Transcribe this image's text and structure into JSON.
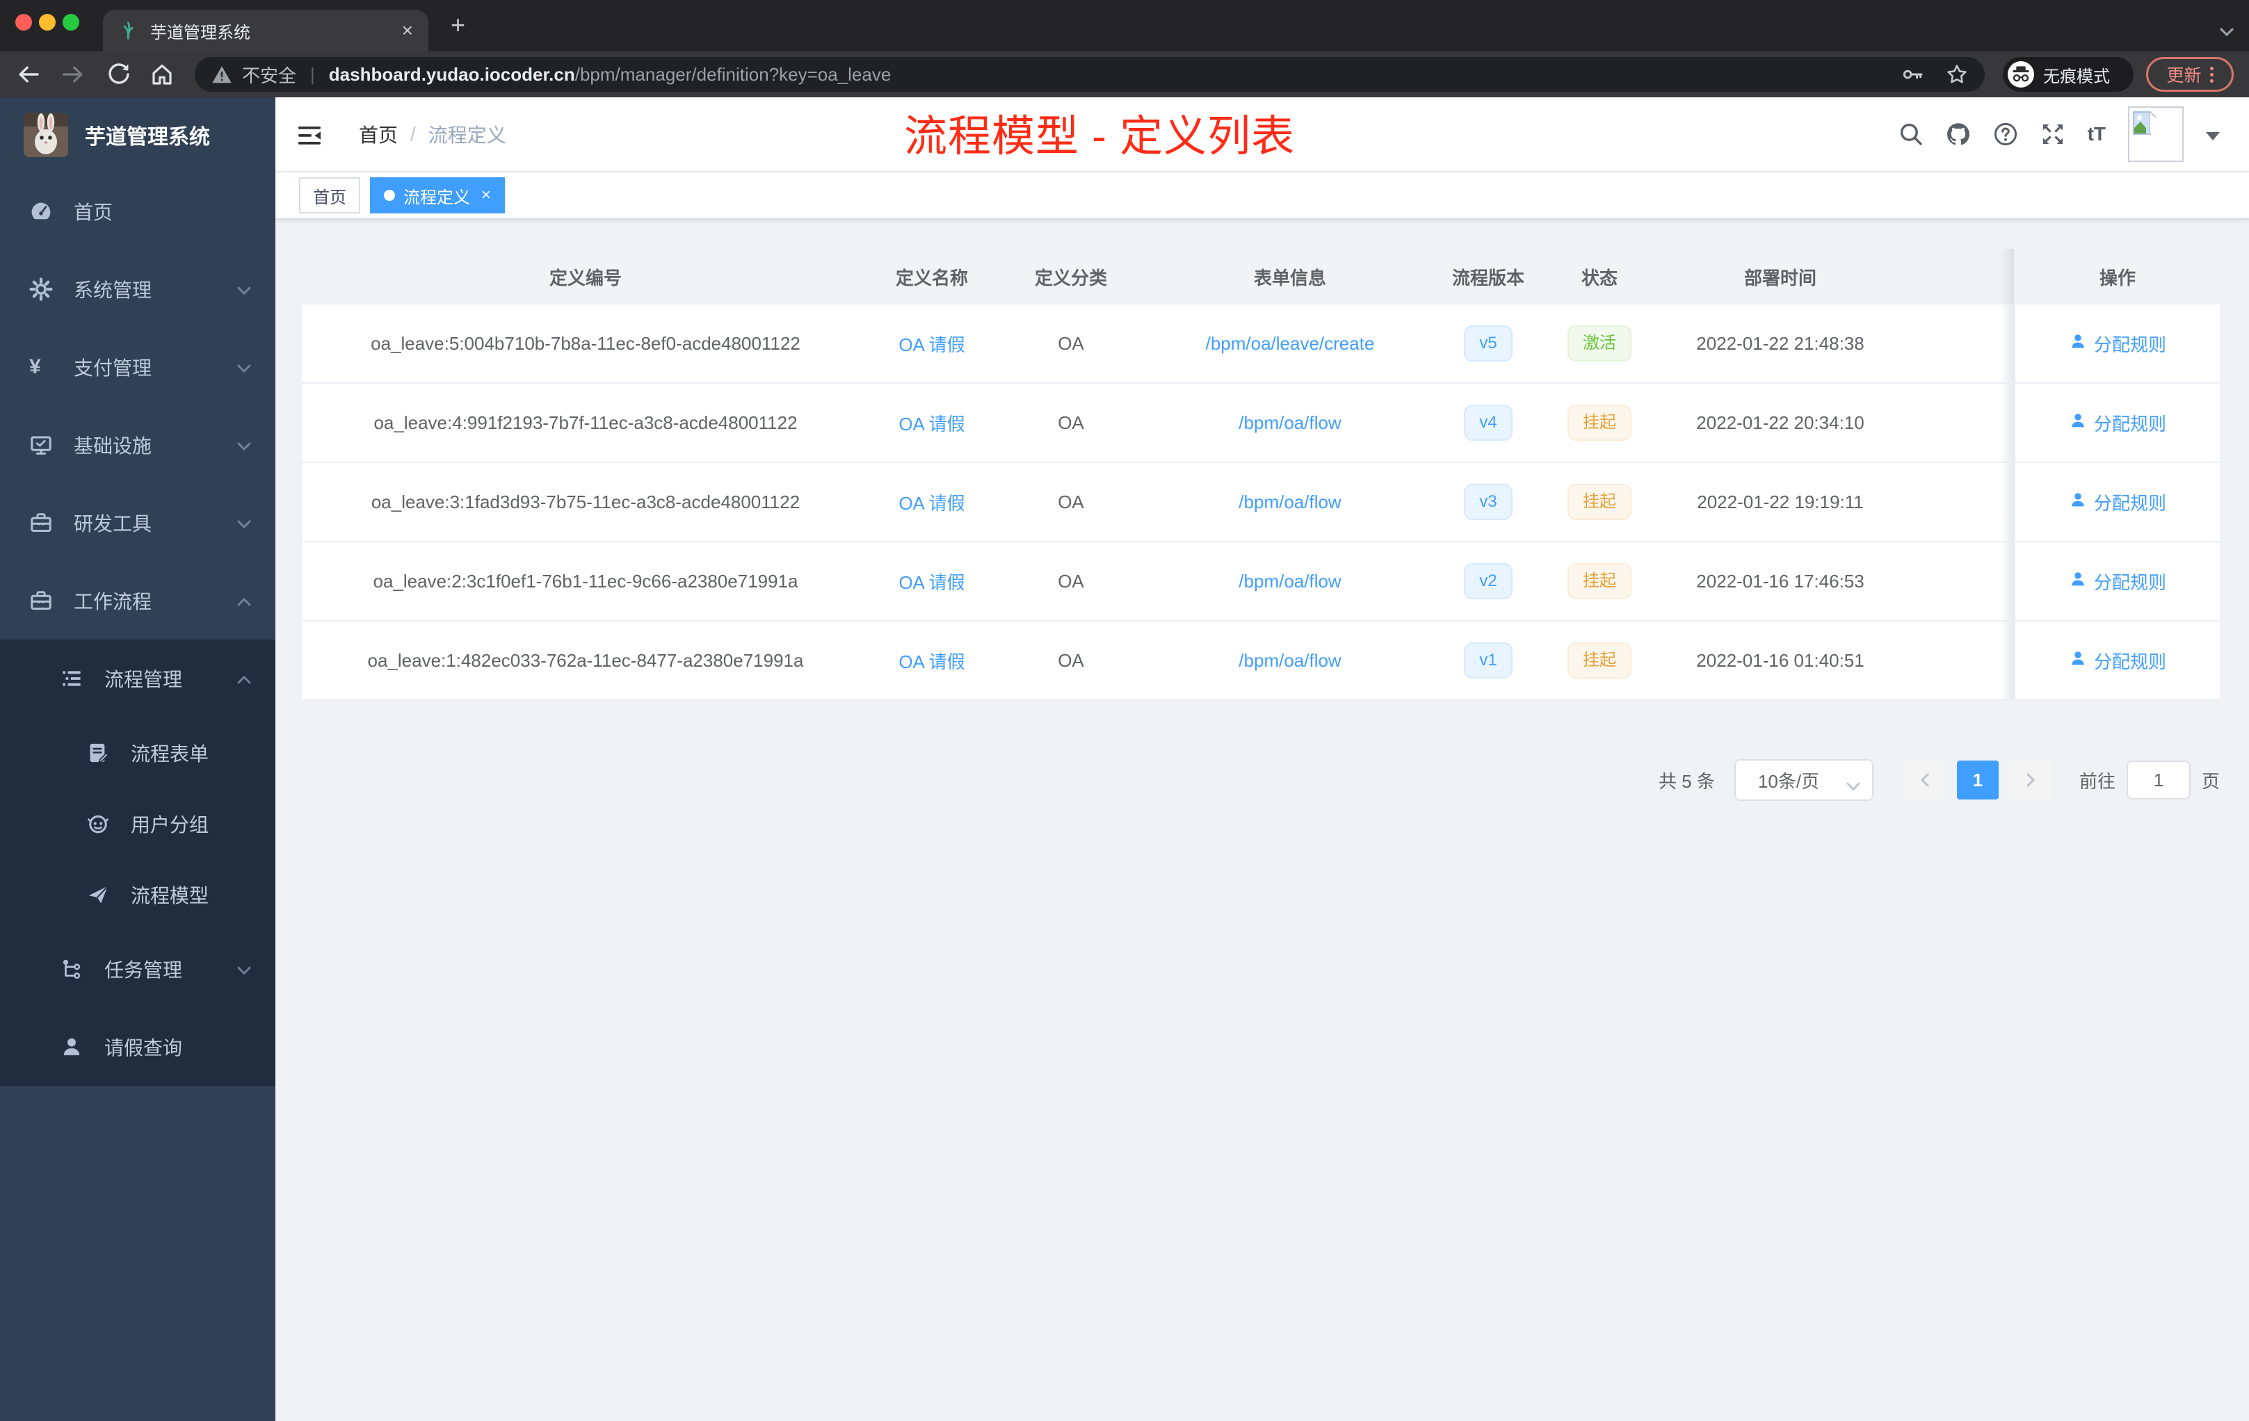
{
  "browser": {
    "tab_title": "芋道管理系统",
    "tab_close": "×",
    "new_tab": "+",
    "security_label": "不安全",
    "url_host": "dashboard.yudao.iocoder.cn",
    "url_path": "/bpm/manager/definition?key=oa_leave",
    "incognito_label": "无痕模式",
    "update_label": "更新"
  },
  "sidebar": {
    "title": "芋道管理系统",
    "menu": [
      {
        "key": "home",
        "label": "首页",
        "icon": "dashboard-icon",
        "level": 1,
        "sub": false,
        "arrow": ""
      },
      {
        "key": "system",
        "label": "系统管理",
        "icon": "gear-icon",
        "level": 1,
        "sub": false,
        "arrow": "down"
      },
      {
        "key": "payment",
        "label": "支付管理",
        "icon": "yen-icon",
        "level": 1,
        "sub": false,
        "arrow": "down"
      },
      {
        "key": "infra",
        "label": "基础设施",
        "icon": "monitor-icon",
        "level": 1,
        "sub": false,
        "arrow": "down"
      },
      {
        "key": "devtools",
        "label": "研发工具",
        "icon": "toolbox-icon",
        "level": 1,
        "sub": false,
        "arrow": "down"
      },
      {
        "key": "workflow",
        "label": "工作流程",
        "icon": "toolbox-icon",
        "level": 1,
        "sub": false,
        "arrow": "up"
      },
      {
        "key": "process-manage",
        "label": "流程管理",
        "icon": "list-tree-icon",
        "level": 2,
        "sub": true,
        "arrow": "up"
      },
      {
        "key": "process-form",
        "label": "流程表单",
        "icon": "form-edit-icon",
        "level": 3,
        "sub": true,
        "arrow": ""
      },
      {
        "key": "user-group",
        "label": "用户分组",
        "icon": "robot-icon",
        "level": 3,
        "sub": true,
        "arrow": ""
      },
      {
        "key": "process-model",
        "label": "流程模型",
        "icon": "paper-plane-icon",
        "level": 3,
        "sub": true,
        "arrow": ""
      },
      {
        "key": "task-manage",
        "label": "任务管理",
        "icon": "tasks-icon",
        "level": 2,
        "sub": true,
        "arrow": "down"
      },
      {
        "key": "leave-query",
        "label": "请假查询",
        "icon": "user-icon",
        "level": 2,
        "sub": true,
        "arrow": ""
      }
    ]
  },
  "app_header": {
    "breadcrumb": [
      "首页",
      "流程定义"
    ],
    "breadcrumb_sep": "/",
    "annotation": "流程模型 - 定义列表"
  },
  "tags": [
    {
      "label": "首页",
      "active": false
    },
    {
      "label": "流程定义",
      "active": true,
      "close": "×"
    }
  ],
  "table": {
    "columns": [
      "定义编号",
      "定义名称",
      "定义分类",
      "表单信息",
      "流程版本",
      "状态",
      "部署时间",
      "操作"
    ],
    "action_label": "分配规则",
    "rows": [
      {
        "id": "oa_leave:5:004b710b-7b8a-11ec-8ef0-acde48001122",
        "name": "OA 请假",
        "category": "OA",
        "form": "/bpm/oa/leave/create",
        "version": "v5",
        "status": "激活",
        "status_type": "success",
        "time": "2022-01-22 21:48:38"
      },
      {
        "id": "oa_leave:4:991f2193-7b7f-11ec-a3c8-acde48001122",
        "name": "OA 请假",
        "category": "OA",
        "form": "/bpm/oa/flow",
        "version": "v4",
        "status": "挂起",
        "status_type": "warning",
        "time": "2022-01-22 20:34:10"
      },
      {
        "id": "oa_leave:3:1fad3d93-7b75-11ec-a3c8-acde48001122",
        "name": "OA 请假",
        "category": "OA",
        "form": "/bpm/oa/flow",
        "version": "v3",
        "status": "挂起",
        "status_type": "warning",
        "time": "2022-01-22 19:19:11"
      },
      {
        "id": "oa_leave:2:3c1f0ef1-76b1-11ec-9c66-a2380e71991a",
        "name": "OA 请假",
        "category": "OA",
        "form": "/bpm/oa/flow",
        "version": "v2",
        "status": "挂起",
        "status_type": "warning",
        "time": "2022-01-16 17:46:53"
      },
      {
        "id": "oa_leave:1:482ec033-762a-11ec-8477-a2380e71991a",
        "name": "OA 请假",
        "category": "OA",
        "form": "/bpm/oa/flow",
        "version": "v1",
        "status": "挂起",
        "status_type": "warning",
        "time": "2022-01-16 01:40:51"
      }
    ]
  },
  "pagination": {
    "total": "共 5 条",
    "page_size": "10条/页",
    "current": "1",
    "goto_label": "前往",
    "goto_value": "1",
    "page_unit": "页"
  },
  "icons": {
    "yen": "¥",
    "font_size": "tT"
  },
  "colors": {
    "accent": "#409eff",
    "link": "#409eff",
    "success": "#67c23a",
    "warning": "#e6a23c",
    "annotation_red": "#fe2c16",
    "sidebar_bg": "#304156",
    "sidebar_sub_bg": "#1f2d3d",
    "content_bg": "#f0f2f5"
  }
}
